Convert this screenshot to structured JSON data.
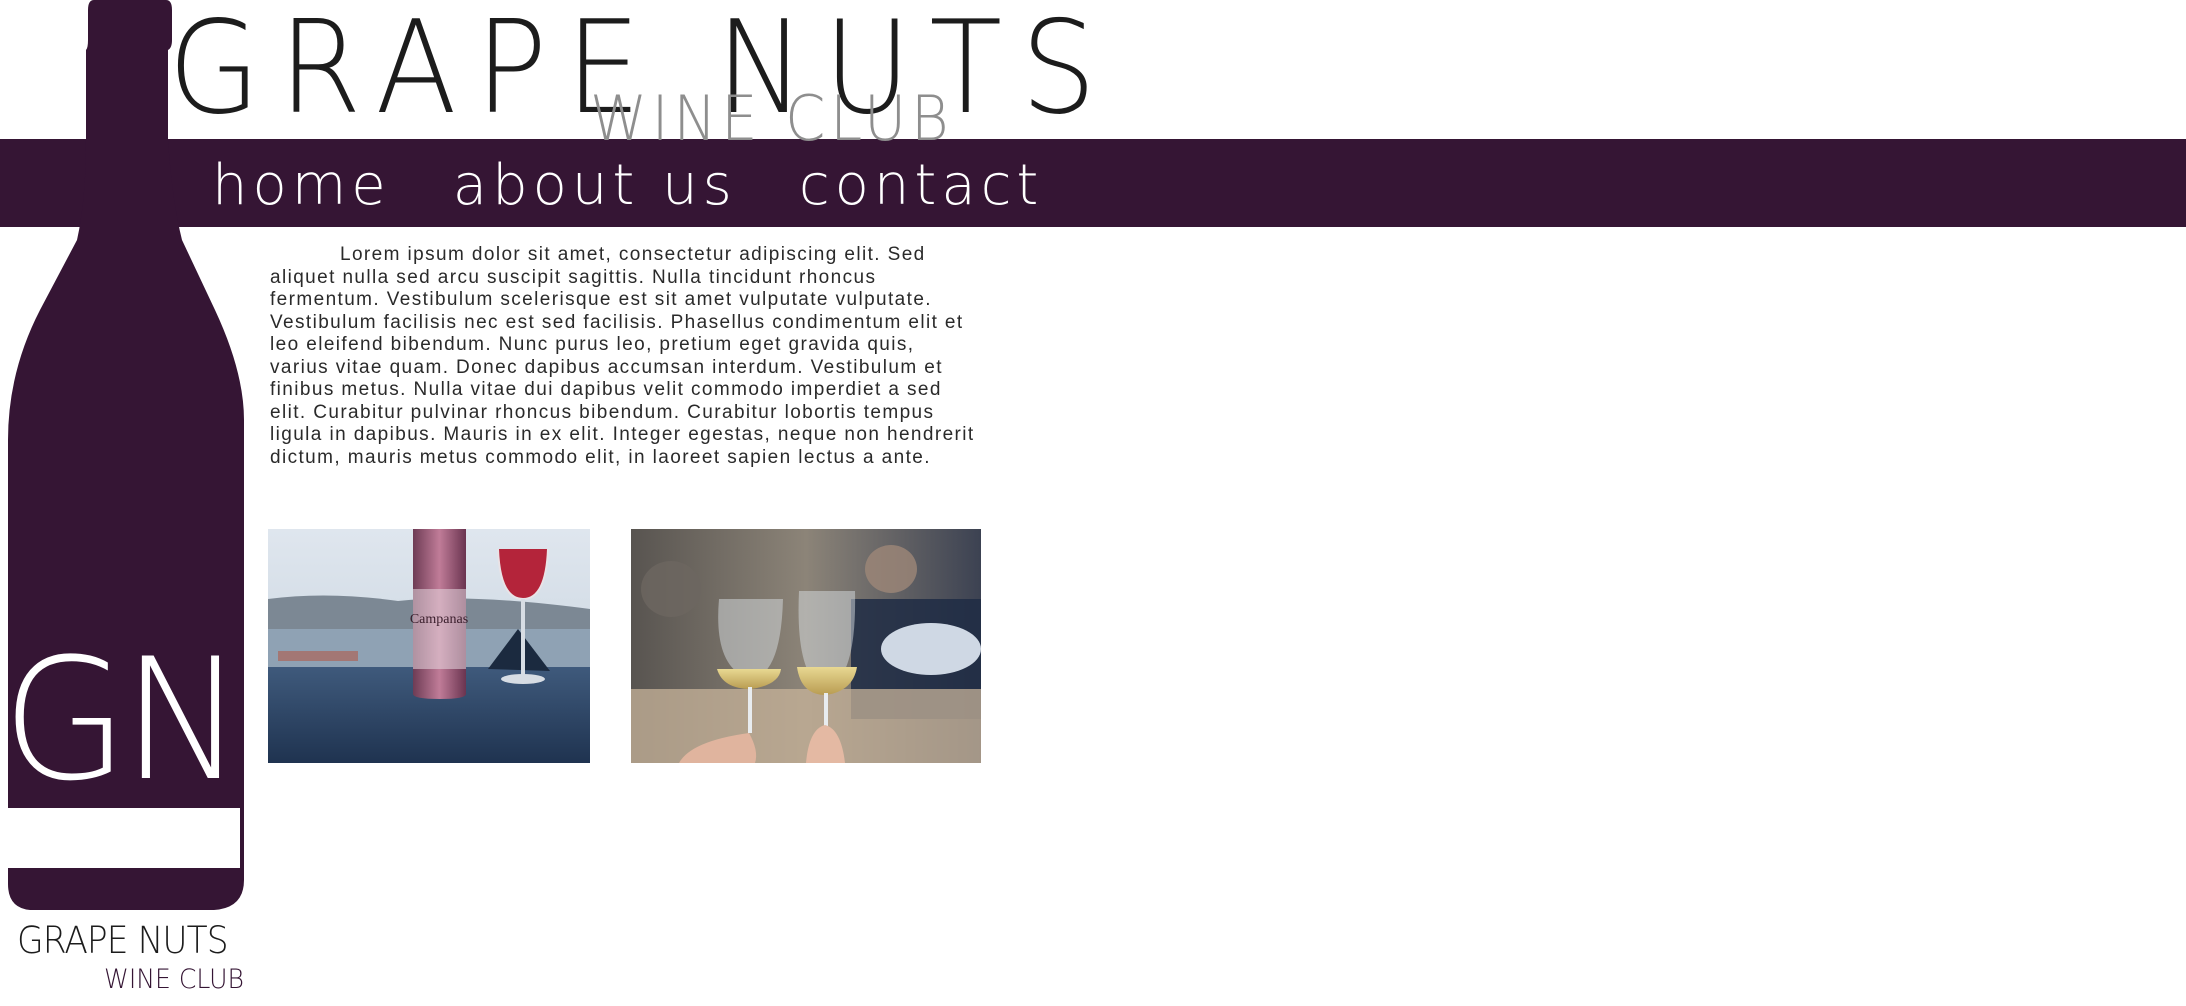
{
  "brand": {
    "title": "GRAPE NUTS",
    "subtitle": "WINE CLUB",
    "monogram": "GN",
    "color": "#351534"
  },
  "nav": {
    "items": [
      {
        "label": "home"
      },
      {
        "label": "about us"
      },
      {
        "label": "contact"
      }
    ]
  },
  "main": {
    "body_text": "Lorem ipsum dolor sit amet, consectetur adipiscing elit. Sed aliquet nulla sed arcu suscipit sagittis. Nulla tincidunt rhoncus fermentum. Vestibulum scelerisque est sit amet vulputate vulputate. Vestibulum facilisis nec est sed facilisis. Phasellus condimentum elit et leo eleifend bibendum. Nunc purus leo, pretium eget gravida quis, varius vitae quam. Donec dapibus accumsan interdum. Vestibulum et finibus metus. Nulla vitae dui dapibus velit commodo imperdiet a sed elit. Curabitur pulvinar rhoncus bibendum. Curabitur lobortis tempus ligula in dapibus. Mauris in ex elit. Integer egestas, neque non hendrerit dictum, mauris metus commodo elit, in laoreet sapien lectus a ante.",
    "photos": [
      {
        "label": "Campanas",
        "icon": "wine-bottle-photo"
      },
      {
        "icon": "wine-toast-photo"
      }
    ]
  },
  "footer": {
    "title": "GRAPE NUTS",
    "subtitle": "WINE CLUB"
  }
}
